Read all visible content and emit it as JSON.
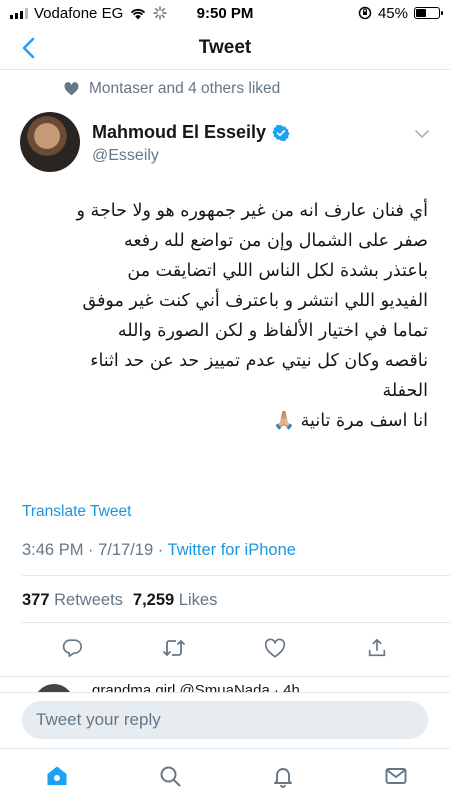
{
  "status_bar": {
    "carrier": "Vodafone EG",
    "time": "9:50 PM",
    "battery_percent": "45%",
    "battery_level": 0.45
  },
  "nav": {
    "title": "Tweet"
  },
  "liked_by": "Montaser and 4 others liked",
  "author": {
    "name": "Mahmoud El Esseily",
    "handle": "@Esseily",
    "verified": true
  },
  "tweet": {
    "lines": [
      "أي فنان عارف انه من غير جمهوره هو ولا حاجة و",
      "صفر على الشمال وإن من تواضع لله رفعه",
      "باعتذر بشدة لكل الناس اللي اتضايقت من",
      "الفيديو اللي انتشر و باعترف أني كنت غير موفق",
      "تماما في اختيار الألفاظ و لكن الصورة والله",
      "ناقصه وكان كل نيتي عدم تمييز حد عن حد اثناء",
      "الحفلة",
      "انا اسف مرة تانية 🙏🏼"
    ],
    "translate_label": "Translate Tweet",
    "timestamp": "3:46 PM · 7/17/19 · ",
    "source": "Twitter for iPhone"
  },
  "stats": {
    "retweets_count": "377",
    "retweets_label": "Retweets",
    "likes_count": "7,259",
    "likes_label": "Likes"
  },
  "reply_peek": {
    "text": "grandma girl @SmuaNada · 4h"
  },
  "composer": {
    "placeholder": "Tweet your reply"
  },
  "colors": {
    "accent": "#1da1f2",
    "link": "#1b95e0",
    "secondary_text": "#657786",
    "divider": "#e1e8ed"
  },
  "icons": {
    "tabs": [
      "home-icon",
      "search-icon",
      "notifications-icon",
      "messages-icon"
    ],
    "actions": [
      "reply-icon",
      "retweet-icon",
      "like-icon",
      "share-icon"
    ]
  }
}
